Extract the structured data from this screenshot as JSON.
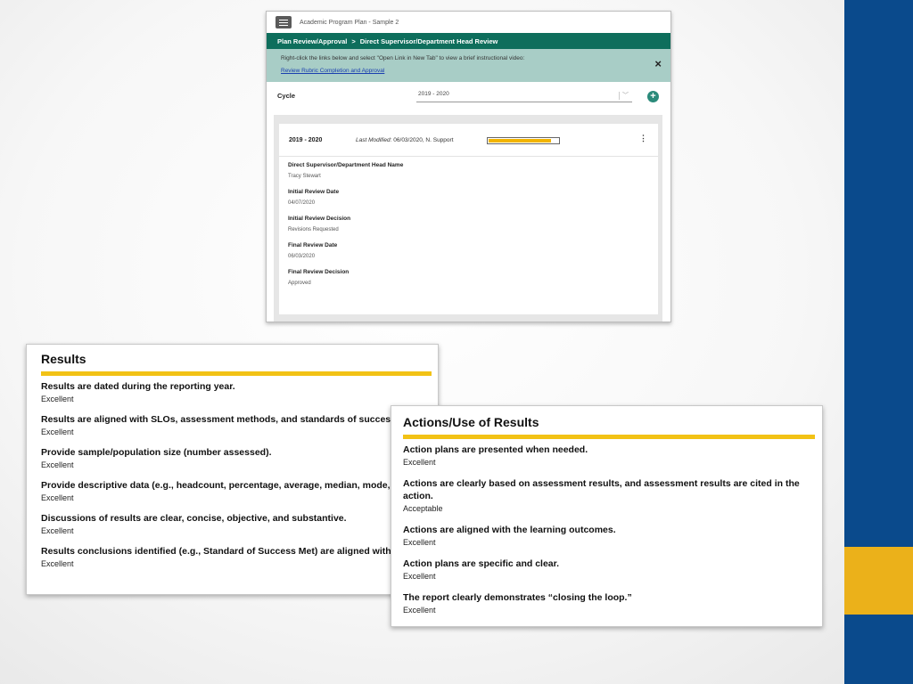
{
  "app": {
    "window_title": "Academic Program Plan - Sample 2",
    "breadcrumb": [
      "Plan Review/Approval",
      "Direct Supervisor/Department Head Review"
    ],
    "breadcrumb_sep": ">",
    "info_text": "Right-click the links below and select \"Open Link in New Tab\" to view a brief instructional video:",
    "info_link": "Review Rubric Completion and Approval",
    "close_icon": "×",
    "cycle_label": "Cycle",
    "cycle_value": "2019 - 2020",
    "add_icon": "+",
    "card": {
      "year": "2019 - 2020",
      "modified_label": "Last Modified:",
      "modified_value": "06/03/2020, N. Support",
      "progress_fraction": 0.9,
      "fields": [
        {
          "label": "Direct Supervisor/Department Head Name",
          "value": "Tracy Stewart"
        },
        {
          "label": "Initial Review Date",
          "value": "04/07/2020"
        },
        {
          "label": "Initial Review Decision",
          "value": "Revisions Requested"
        },
        {
          "label": "Final Review Date",
          "value": "06/03/2020"
        },
        {
          "label": "Final Review Decision",
          "value": "Approved"
        }
      ]
    }
  },
  "results": {
    "title": "Results",
    "items": [
      {
        "q": "Results are dated during the reporting year.",
        "a": "Excellent"
      },
      {
        "q": "Results are aligned with SLOs, assessment methods, and standards of success.",
        "a": "Excellent"
      },
      {
        "q": "Provide sample/population size (number assessed).",
        "a": "Excellent"
      },
      {
        "q": "Provide descriptive data (e.g., headcount, percentage, average, median, mode, etc.).",
        "a": "Excellent"
      },
      {
        "q": "Discussions of results are clear, concise, objective, and substantive.",
        "a": "Excellent"
      },
      {
        "q": "Results conclusions identified (e.g., Standard of Success Met) are aligned with results provided.",
        "a": "Excellent"
      }
    ]
  },
  "actions": {
    "title": "Actions/Use of Results",
    "items": [
      {
        "q": "Action plans are presented when needed.",
        "a": "Excellent"
      },
      {
        "q": "Actions are clearly based on assessment results, and assessment results are cited in the action.",
        "a": "Acceptable"
      },
      {
        "q": "Actions are aligned with the learning outcomes.",
        "a": "Excellent"
      },
      {
        "q": "Action plans are specific and clear.",
        "a": "Excellent"
      },
      {
        "q": "The report clearly demonstrates “closing the loop.”",
        "a": "Excellent"
      }
    ]
  },
  "colors": {
    "header_green": "#0e6e5c",
    "info_teal": "#a8cdc6",
    "gold": "#f2c215",
    "side_blue": "#0a4a8c",
    "side_gold": "#ebb11a"
  }
}
